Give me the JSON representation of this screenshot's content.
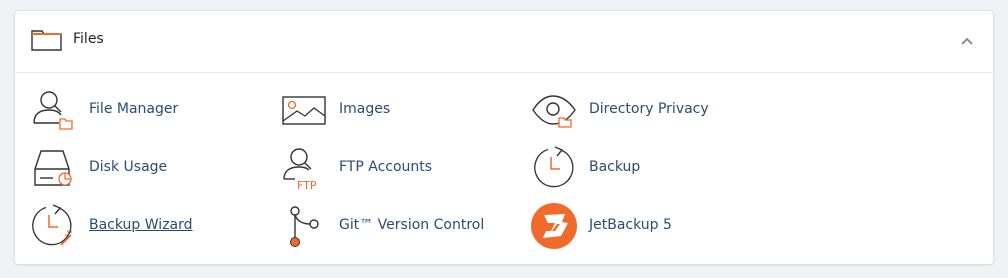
{
  "section": {
    "title": "Files",
    "header_icon": "folder-icon",
    "collapse_icon": "chevron-up-icon"
  },
  "colors": {
    "accent": "#f26a2b",
    "link": "#2a4c73",
    "icon_stroke": "#333333"
  },
  "items": [
    {
      "label": "File Manager",
      "icon": "file-manager-icon"
    },
    {
      "label": "Images",
      "icon": "images-icon"
    },
    {
      "label": "Directory Privacy",
      "icon": "directory-privacy-icon"
    },
    {
      "label": "Disk Usage",
      "icon": "disk-usage-icon"
    },
    {
      "label": "FTP Accounts",
      "icon": "ftp-accounts-icon",
      "badge": "FTP"
    },
    {
      "label": "Backup",
      "icon": "backup-icon"
    },
    {
      "label": "Backup Wizard",
      "icon": "backup-wizard-icon"
    },
    {
      "label": "Git™ Version Control",
      "icon": "git-icon"
    },
    {
      "label": "JetBackup 5",
      "icon": "jetbackup-icon"
    }
  ]
}
